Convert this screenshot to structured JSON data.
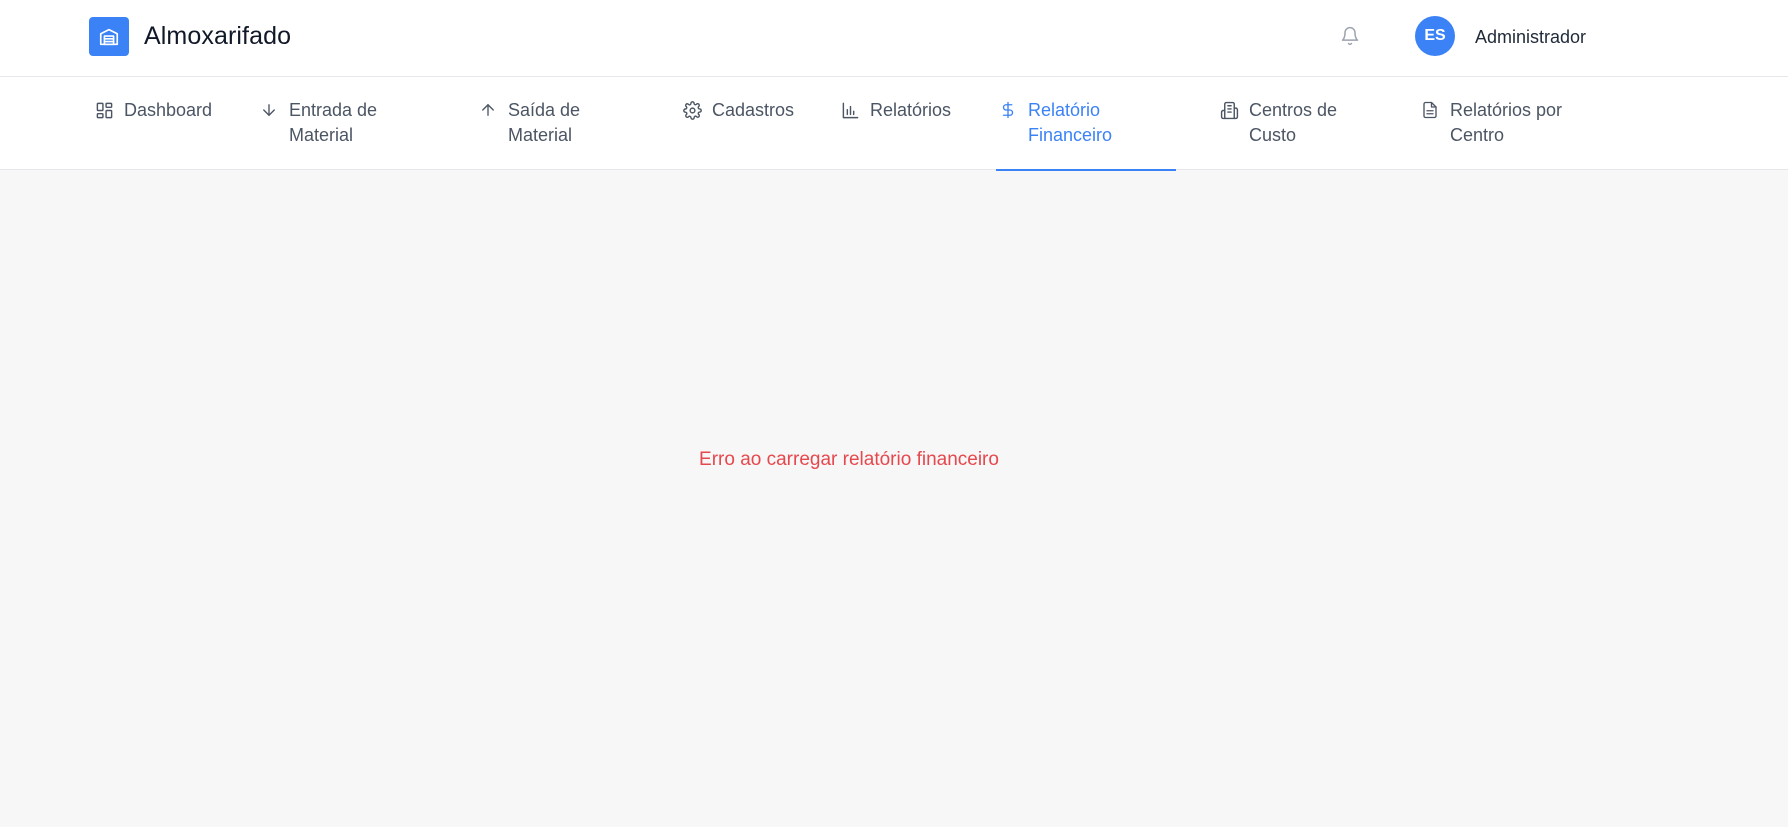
{
  "app": {
    "title": "Almoxarifado",
    "logo_icon": "warehouse-icon",
    "accent_color": "#3b82f6"
  },
  "header": {
    "notifications_icon": "bell-icon",
    "avatar_initials": "ES",
    "user_name": "Administrador"
  },
  "nav": {
    "items": [
      {
        "label": "Dashboard",
        "icon": "dashboard-grid-icon",
        "active": false
      },
      {
        "label": "Entrada de Material",
        "icon": "arrow-down-icon",
        "active": false
      },
      {
        "label": "Saída de Material",
        "icon": "arrow-up-icon",
        "active": false
      },
      {
        "label": "Cadastros",
        "icon": "gear-icon",
        "active": false
      },
      {
        "label": "Relatórios",
        "icon": "bar-chart-icon",
        "active": false
      },
      {
        "label": "Relatório Financeiro",
        "icon": "dollar-icon",
        "active": true
      },
      {
        "label": "Centros de Custo",
        "icon": "building-icon",
        "active": false
      },
      {
        "label": "Relatórios por Centro",
        "icon": "document-icon",
        "active": false
      }
    ]
  },
  "main": {
    "error_message": "Erro ao carregar relatório financeiro",
    "error_color": "#e5484d"
  }
}
